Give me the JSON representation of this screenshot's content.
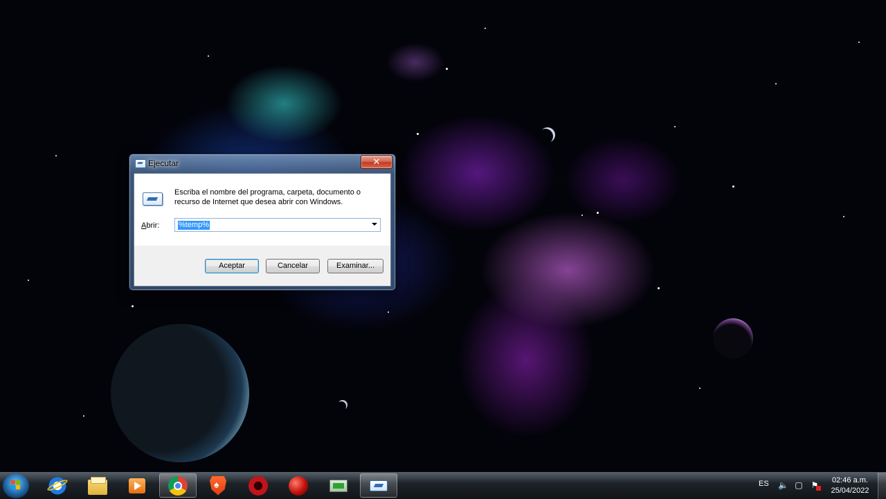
{
  "dialog": {
    "title": "Ejecutar",
    "close_symbol": "✕",
    "description_line1": "Escriba el nombre del programa, carpeta, documento o",
    "description_line2": "recurso de Internet que desea abrir con Windows.",
    "open_label_accel": "A",
    "open_label_rest": "brir:",
    "open_value": "%temp%",
    "ok_label": "Aceptar",
    "cancel_label": "Cancelar",
    "browse_label": "Examinar..."
  },
  "taskbar": {
    "apps": [
      {
        "name": "internet-explorer-icon"
      },
      {
        "name": "file-explorer-icon"
      },
      {
        "name": "media-player-icon"
      },
      {
        "name": "chrome-icon"
      },
      {
        "name": "brave-icon"
      },
      {
        "name": "game-launcher-icon"
      },
      {
        "name": "red-ball-app-icon"
      },
      {
        "name": "terminal-app-icon"
      },
      {
        "name": "run-dialog-task-icon"
      }
    ],
    "language": "ES",
    "time": "02:46 a.m.",
    "date": "25/04/2022"
  }
}
